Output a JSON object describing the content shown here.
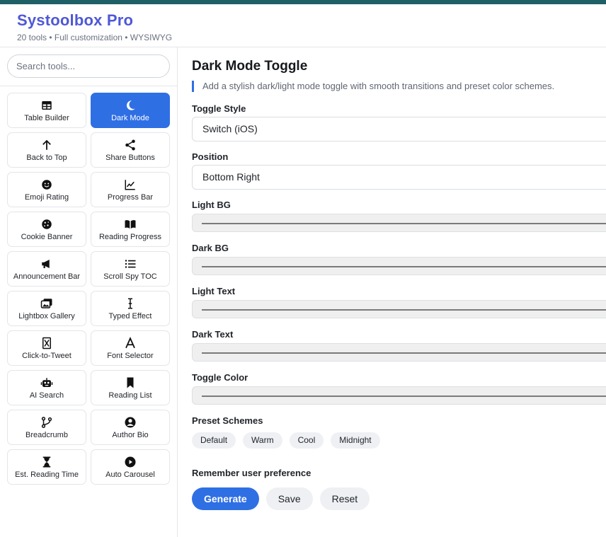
{
  "app": {
    "title": "Systoolbox Pro",
    "subtitle": "20 tools • Full customization • WYSIWYG",
    "accent": "#2f6fe4",
    "brand_color": "#4f58d6"
  },
  "sidebar": {
    "search_placeholder": "Search tools...",
    "tools": [
      {
        "label": "Table Builder",
        "icon": "table-icon"
      },
      {
        "label": "Dark Mode",
        "icon": "moon-icon",
        "active": true
      },
      {
        "label": "Back to Top",
        "icon": "arrow-up-icon"
      },
      {
        "label": "Share Buttons",
        "icon": "share-icon"
      },
      {
        "label": "Emoji Rating",
        "icon": "smiley-icon"
      },
      {
        "label": "Progress Bar",
        "icon": "line-chart-icon"
      },
      {
        "label": "Cookie Banner",
        "icon": "cookie-icon"
      },
      {
        "label": "Reading Progress",
        "icon": "book-icon"
      },
      {
        "label": "Announcement Bar",
        "icon": "megaphone-icon"
      },
      {
        "label": "Scroll Spy TOC",
        "icon": "list-icon"
      },
      {
        "label": "Lightbox Gallery",
        "icon": "images-icon"
      },
      {
        "label": "Typed Effect",
        "icon": "text-cursor-icon"
      },
      {
        "label": "Click-to-Tweet",
        "icon": "x-logo-icon"
      },
      {
        "label": "Font Selector",
        "icon": "font-icon"
      },
      {
        "label": "AI Search",
        "icon": "robot-icon"
      },
      {
        "label": "Reading List",
        "icon": "bookmark-icon"
      },
      {
        "label": "Breadcrumb",
        "icon": "branch-icon"
      },
      {
        "label": "Author Bio",
        "icon": "user-circle-icon"
      },
      {
        "label": "Est. Reading Time",
        "icon": "hourglass-icon"
      },
      {
        "label": "Auto Carousel",
        "icon": "play-circle-icon"
      }
    ]
  },
  "main": {
    "title": "Dark Mode Toggle",
    "description": "Add a stylish dark/light mode toggle with smooth transitions and preset color schemes.",
    "toggle_style": {
      "label": "Toggle Style",
      "value": "Switch (iOS)"
    },
    "position": {
      "label": "Position",
      "value": "Bottom Right"
    },
    "colors": [
      {
        "label": "Light BG"
      },
      {
        "label": "Dark BG"
      },
      {
        "label": "Light Text"
      },
      {
        "label": "Dark Text"
      },
      {
        "label": "Toggle Color"
      }
    ],
    "presets_label": "Preset Schemes",
    "presets": [
      "Default",
      "Warm",
      "Cool",
      "Midnight"
    ],
    "remember_label": "Remember user preference",
    "buttons": {
      "generate": "Generate",
      "save": "Save",
      "reset": "Reset"
    }
  }
}
